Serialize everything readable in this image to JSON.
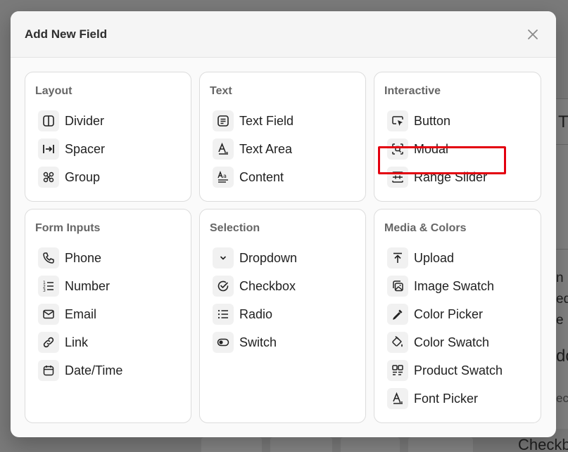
{
  "modal": {
    "title": "Add New Field",
    "close_label": "×"
  },
  "background": {
    "fragments": [
      "T",
      "n ip",
      "ed",
      "e n",
      "do",
      "ect",
      "Checkb"
    ]
  },
  "cards": [
    {
      "title": "Layout",
      "items": [
        {
          "label": "Divider",
          "icon": "divider-icon"
        },
        {
          "label": "Spacer",
          "icon": "spacer-icon"
        },
        {
          "label": "Group",
          "icon": "group-icon"
        }
      ]
    },
    {
      "title": "Text",
      "items": [
        {
          "label": "Text Field",
          "icon": "text-field-icon"
        },
        {
          "label": "Text Area",
          "icon": "text-area-icon"
        },
        {
          "label": "Content",
          "icon": "content-icon"
        }
      ]
    },
    {
      "title": "Interactive",
      "items": [
        {
          "label": "Button",
          "icon": "button-cursor-icon"
        },
        {
          "label": "Modal",
          "icon": "modal-icon",
          "highlighted": true
        },
        {
          "label": "Range Slider",
          "icon": "range-slider-icon"
        }
      ]
    },
    {
      "title": "Form Inputs",
      "items": [
        {
          "label": "Phone",
          "icon": "phone-icon"
        },
        {
          "label": "Number",
          "icon": "number-list-icon"
        },
        {
          "label": "Email",
          "icon": "email-icon"
        },
        {
          "label": "Link",
          "icon": "link-icon"
        },
        {
          "label": "Date/Time",
          "icon": "calendar-icon"
        }
      ]
    },
    {
      "title": "Selection",
      "items": [
        {
          "label": "Dropdown",
          "icon": "chevron-down-icon"
        },
        {
          "label": "Checkbox",
          "icon": "check-circle-icon"
        },
        {
          "label": "Radio",
          "icon": "radio-list-icon"
        },
        {
          "label": "Switch",
          "icon": "toggle-icon"
        }
      ]
    },
    {
      "title": "Media & Colors",
      "items": [
        {
          "label": "Upload",
          "icon": "upload-icon"
        },
        {
          "label": "Image Swatch",
          "icon": "image-swatch-icon"
        },
        {
          "label": "Color Picker",
          "icon": "eyedropper-icon"
        },
        {
          "label": "Color Swatch",
          "icon": "paint-bucket-icon"
        },
        {
          "label": "Product Swatch",
          "icon": "product-swatch-icon"
        },
        {
          "label": "Font Picker",
          "icon": "font-icon"
        }
      ]
    }
  ],
  "colors": {
    "highlight": "#e3000f",
    "card_border": "#dcdcdc",
    "icon_bg": "#f1f1f1"
  }
}
